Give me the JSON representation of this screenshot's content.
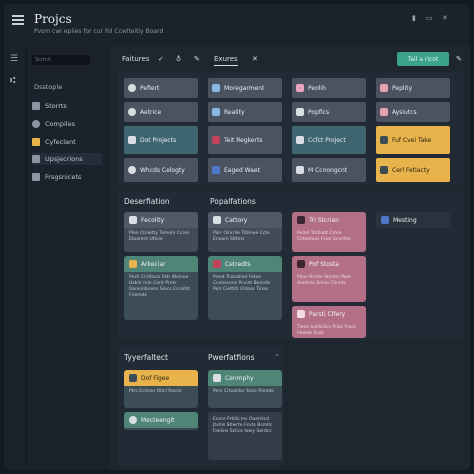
{
  "header": {
    "title": "Projcs",
    "subtitle": "Pvsm cwi epiies for cur fol Ccwlteitiy Board",
    "controls": [
      "▮",
      "▭",
      "✕"
    ]
  },
  "sidebar": {
    "search_placeholder": "Scrtch",
    "heading": "Dsstople",
    "items": [
      {
        "label": "Storrts",
        "icon": "grid-icon",
        "color": "#8a94a2"
      },
      {
        "label": "Compiles",
        "icon": "globe-icon",
        "color": "#8a94a2"
      },
      {
        "label": "Cyfeclant",
        "icon": "folder-icon",
        "color": "#e8b34a"
      },
      {
        "label": "Upsjecrions",
        "icon": "list-icon",
        "color": "#8a94a2"
      },
      {
        "label": "Frsgsnicets",
        "icon": "doc-icon",
        "color": "#8a94a2"
      }
    ]
  },
  "toolbar": {
    "features_label": "Faitures",
    "check": "✓",
    "pin": "♁",
    "pen": "✎",
    "tab_label": "Exures",
    "close": "✕",
    "add_button": "Tail a ricot",
    "edit": "✎"
  },
  "top_tiles": [
    {
      "label": "Pefiert",
      "style": "grey",
      "icon_color": "#d9dee5"
    },
    {
      "label": "Moregarment",
      "style": "grey",
      "icon_color": "#8fb7e6"
    },
    {
      "label": "Peolih",
      "style": "grey",
      "icon_color": "#e8a3ba"
    },
    {
      "label": "Peplity",
      "style": "grey",
      "icon_color": "#e8a3ba"
    },
    {
      "label": "Aetrice",
      "style": "grey",
      "icon_color": "#d9dee5"
    },
    {
      "label": "Reality",
      "style": "grey",
      "icon_color": "#8fb7e6"
    },
    {
      "label": "Popfics",
      "style": "grey",
      "icon_color": "#d9dee5"
    },
    {
      "label": "Aysiutcs",
      "style": "grey",
      "icon_color": "#e8a3ba"
    },
    {
      "label": "Dot Projects",
      "style": "teal",
      "icon_color": "#d9dee5"
    },
    {
      "label": "Teit Regkerts",
      "style": "grey",
      "icon_color": "#c2415c"
    },
    {
      "label": "Ccfct Project",
      "style": "teal",
      "icon_color": "#d9dee5"
    },
    {
      "label": "Fuf Cvei Take",
      "style": "gold",
      "icon_color": "#3c4d57"
    },
    {
      "label": "Whcds Celogty",
      "style": "grey",
      "icon_color": "#d9dee5"
    },
    {
      "label": "Eaged Waet",
      "style": "grey",
      "icon_color": "#4f76c9"
    },
    {
      "label": "M Ccnongcnt",
      "style": "grey",
      "icon_color": "#d9dee5"
    },
    {
      "label": "Cerl Fetlacty",
      "style": "gold",
      "icon_color": "#3c4d57"
    }
  ],
  "section_a": {
    "title_left": "Deserfiation",
    "title_right": "Popalfations",
    "cards": [
      {
        "title": "Fecolity",
        "style": "c-slate",
        "body": "Plen Ctnietty Telnem Ccres Etoomre Utlnie"
      },
      {
        "title": "Cattory",
        "style": "c-slate",
        "body": "Parr Oinrrlle Tltimee Ccte Enaom Sittms"
      },
      {
        "title": "Arkeciar",
        "style": "c-teal",
        "body": "Pezh Ciritllucs Fatr Weinoe Usbiir Inlir Cent Prnts Ooninlibnens Slecs Crcoifst Fnemds"
      },
      {
        "title": "Cetredts",
        "style": "c-teal",
        "body": "Preat Tcsorbliet Fetan Cceisienns Pcvint Bomdis Pelr Cieltliti Clitoor Tinas"
      },
      {
        "title": "Tri Stcrian",
        "style": "c-rose",
        "body": "Pelnd Tcstiiatt Cmre Chteeloes Fslor Scenfes"
      },
      {
        "title": "Pof Stosta",
        "style": "c-rose",
        "body": "Plioe Bsrrte Sticten Peer Anidnes Snlee Clinets"
      },
      {
        "title": "Parsti Clfery",
        "style": "c-rose",
        "body": "Tiese Sotilsliics Pctic Fracs Iieolde Scsll"
      },
      {
        "title": "Mesting",
        "style": "c-slate",
        "body": ""
      }
    ]
  },
  "section_b": {
    "title_left": "Tyyerfaltect",
    "title_right": "Pwerfatfions",
    "cards": [
      {
        "title": "Dof Figee",
        "style": "c-gold",
        "body": "Ptrs Ecimes Oitcl Roccir"
      },
      {
        "title": "Cenmphy",
        "style": "c-teal",
        "body": "Pers Crtoalilor Soce Rimlde"
      },
      {
        "title": "Mecteenglt",
        "style": "c-teal",
        "body": ""
      },
      {
        "title": "",
        "style": "c-slate",
        "body": "Eorce Prtlliicms Ooemlcd Jtvhis Stlwrte Fcvts Bsmitc Faeiins Sclice Ioeiy Serdcs"
      }
    ]
  }
}
